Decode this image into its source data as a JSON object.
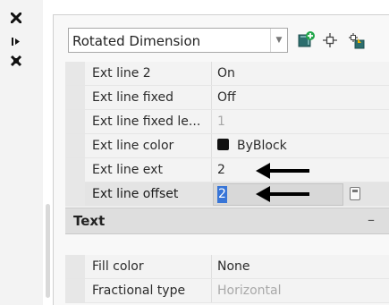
{
  "toolstrip": {
    "close_icon": "close-icon",
    "autohide_icon": "auto-hide-icon",
    "properties_icon": "settings-icon"
  },
  "header": {
    "object_type": "Rotated Dimension",
    "icons": [
      "toggle-pickadd-icon",
      "select-objects-icon",
      "quick-select-icon"
    ]
  },
  "rows": [
    {
      "name": "Ext line 2",
      "value": "On"
    },
    {
      "name": "Ext line fixed",
      "value": "Off"
    },
    {
      "name": "Ext line fixed le...",
      "value": "1"
    },
    {
      "name": "Ext line color",
      "value": "ByBlock",
      "swatch": "#111111"
    },
    {
      "name": "Ext line ext",
      "value": "2"
    },
    {
      "name": "Ext line offset",
      "value": "2"
    }
  ],
  "section": {
    "title": "Text",
    "collapse_symbol": "–"
  },
  "text_rows": [
    {
      "name": "Fill color",
      "value": "None"
    },
    {
      "name": "Fractional type",
      "value": "Horizontal"
    }
  ],
  "colors": {
    "selection": "#3875d7",
    "annotation_arrow": "#000000"
  }
}
